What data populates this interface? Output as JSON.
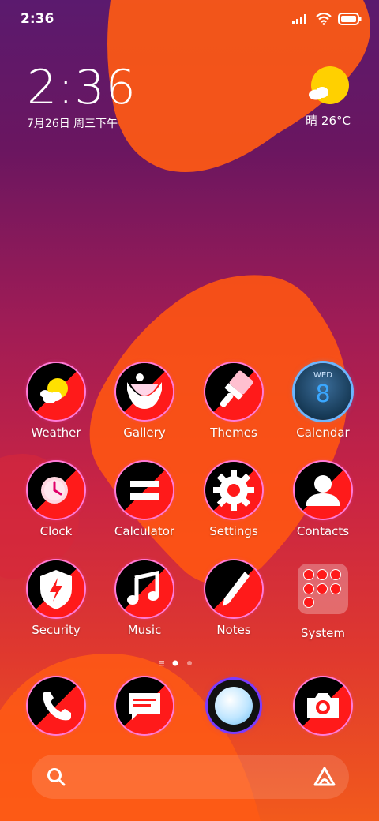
{
  "status_bar": {
    "time": "2:36"
  },
  "clock": {
    "time": "2:36",
    "date": "7月26日 周三下午"
  },
  "weather": {
    "text": "晴 26°C"
  },
  "apps": [
    {
      "label": "Weather",
      "icon": "weather-icon"
    },
    {
      "label": "Gallery",
      "icon": "gallery-icon"
    },
    {
      "label": "Themes",
      "icon": "themes-icon"
    },
    {
      "label": "Calendar",
      "icon": "calendar-icon",
      "weekday": "WED",
      "day": "8"
    },
    {
      "label": "Clock",
      "icon": "clock-icon"
    },
    {
      "label": "Calculator",
      "icon": "calculator-icon"
    },
    {
      "label": "Settings",
      "icon": "settings-icon"
    },
    {
      "label": "Contacts",
      "icon": "contacts-icon"
    },
    {
      "label": "Security",
      "icon": "security-icon"
    },
    {
      "label": "Music",
      "icon": "music-icon"
    },
    {
      "label": "Notes",
      "icon": "notes-icon"
    },
    {
      "label": "System",
      "icon": "system-folder-icon"
    }
  ],
  "dock": [
    {
      "icon": "phone-icon"
    },
    {
      "icon": "messages-icon"
    },
    {
      "icon": "browser-icon"
    },
    {
      "icon": "camera-icon"
    }
  ],
  "page_indicator": {
    "pages": 2,
    "current": 1
  },
  "colors": {
    "accent_red": "#ff1a1a",
    "ring_pink": "#ff7bd8",
    "blob_orange": "#ff5a14"
  }
}
